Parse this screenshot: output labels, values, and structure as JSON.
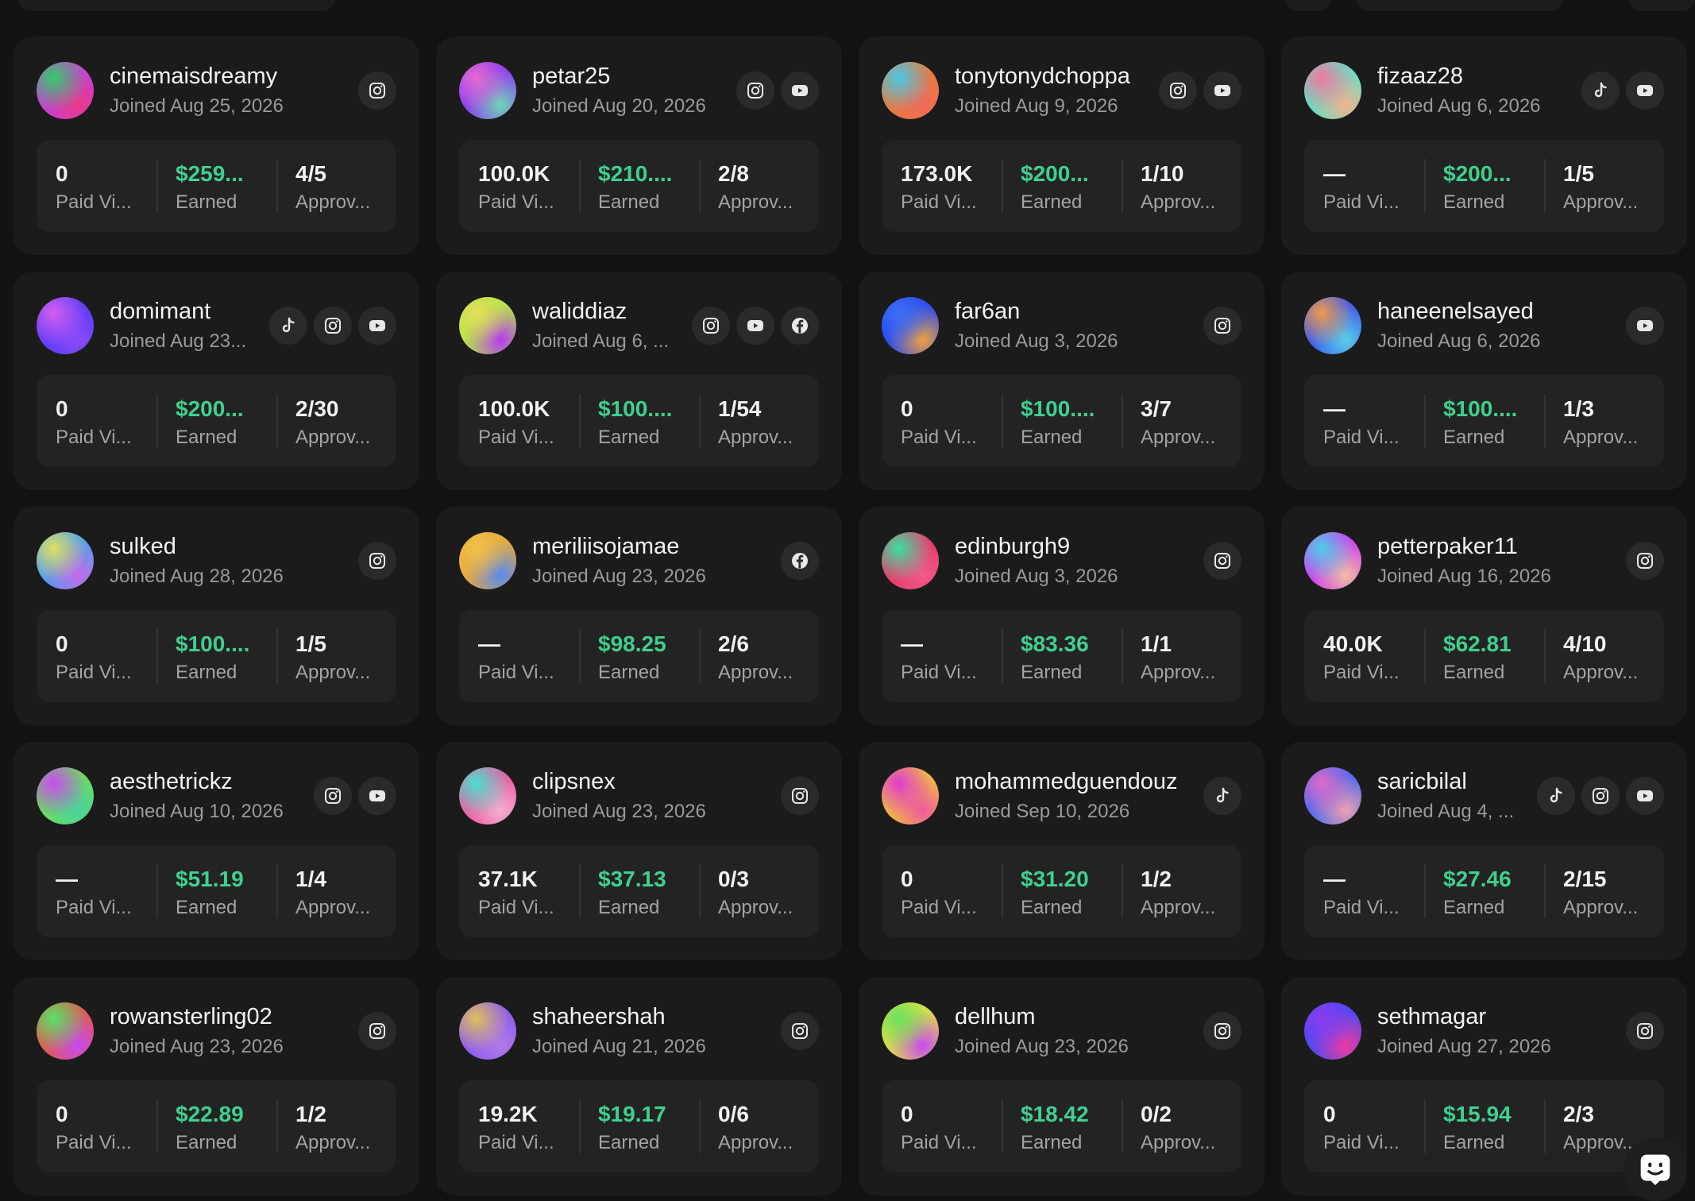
{
  "labels": {
    "views": "Paid Vi...",
    "earned": "Earned",
    "approved": "Approv..."
  },
  "colors": {
    "background": "#121212",
    "card": "#1b1b1b",
    "stat_panel": "#232323",
    "earned_green": "#3fd08f",
    "muted_text": "#9a9a9a"
  },
  "creators": [
    {
      "username": "cinemaisdreamy",
      "joined": "Joined Aug 25, 2026",
      "views": "0",
      "earned": "$259...",
      "approved": "4/5",
      "socials": [
        "instagram-icon"
      ],
      "avatar": [
        "#c93dd6",
        "#35c96a",
        "#e83a8a"
      ]
    },
    {
      "username": "petar25",
      "joined": "Joined Aug 20, 2026",
      "views": "100.0K",
      "earned": "$210....",
      "approved": "2/8",
      "socials": [
        "instagram-icon",
        "youtube-icon"
      ],
      "avatar": [
        "#8a3cf0",
        "#e66bd0",
        "#6fd6b8"
      ]
    },
    {
      "username": "tonytonydchoppa",
      "joined": "Joined Aug 9, 2026",
      "views": "173.0K",
      "earned": "$200...",
      "approved": "1/10",
      "socials": [
        "instagram-icon",
        "youtube-icon"
      ],
      "avatar": [
        "#e87b3c",
        "#4bc7e8",
        "#f06a5a"
      ]
    },
    {
      "username": "fizaaz28",
      "joined": "Joined Aug 6, 2026",
      "views": "—",
      "earned": "$200...",
      "approved": "1/5",
      "socials": [
        "tiktok-icon",
        "youtube-icon"
      ],
      "avatar": [
        "#5fe0c8",
        "#f07aa0",
        "#f2b48c"
      ]
    },
    {
      "username": "domimant",
      "joined": "Joined Aug 23...",
      "views": "0",
      "earned": "$200...",
      "approved": "2/30",
      "socials": [
        "tiktok-icon",
        "instagram-icon",
        "youtube-icon"
      ],
      "avatar": [
        "#5a3cf5",
        "#d55ef0",
        "#8a4af8"
      ]
    },
    {
      "username": "waliddiaz",
      "joined": "Joined Aug 6, ...",
      "views": "100.0K",
      "earned": "$100....",
      "approved": "1/54",
      "socials": [
        "instagram-icon",
        "youtube-icon",
        "facebook-icon"
      ],
      "avatar": [
        "#b6e24a",
        "#e0e05a",
        "#b23cf0"
      ]
    },
    {
      "username": "far6an",
      "joined": "Joined Aug 3, 2026",
      "views": "0",
      "earned": "$100....",
      "approved": "3/7",
      "socials": [
        "instagram-icon"
      ],
      "avatar": [
        "#2a4af0",
        "#3c6ef5",
        "#f0a040"
      ]
    },
    {
      "username": "haneenelsayed",
      "joined": "Joined Aug 6, 2026",
      "views": "—",
      "earned": "$100....",
      "approved": "1/3",
      "socials": [
        "youtube-icon"
      ],
      "avatar": [
        "#3c5af0",
        "#f09a4a",
        "#5ad0e8"
      ]
    },
    {
      "username": "sulked",
      "joined": "Joined Aug 28, 2026",
      "views": "0",
      "earned": "$100....",
      "approved": "1/5",
      "socials": [
        "instagram-icon"
      ],
      "avatar": [
        "#4aa0f0",
        "#e0e060",
        "#c86ae8"
      ]
    },
    {
      "username": "meriliisojamae",
      "joined": "Joined Aug 23, 2026",
      "views": "—",
      "earned": "$98.25",
      "approved": "2/6",
      "socials": [
        "facebook-icon"
      ],
      "avatar": [
        "#e8a83c",
        "#f0c04a",
        "#5a8af0"
      ]
    },
    {
      "username": "edinburgh9",
      "joined": "Joined Aug 3, 2026",
      "views": "—",
      "earned": "$83.36",
      "approved": "1/1",
      "socials": [
        "instagram-icon"
      ],
      "avatar": [
        "#e83a6a",
        "#3ce0a0",
        "#f05a8a"
      ]
    },
    {
      "username": "petterpaker11",
      "joined": "Joined Aug 16, 2026",
      "views": "40.0K",
      "earned": "$62.81",
      "approved": "4/10",
      "socials": [
        "instagram-icon"
      ],
      "avatar": [
        "#d23cf0",
        "#4ad0e8",
        "#f0c0a0"
      ]
    },
    {
      "username": "aesthetrickz",
      "joined": "Joined Aug 10, 2026",
      "views": "—",
      "earned": "$51.19",
      "approved": "1/4",
      "socials": [
        "instagram-icon",
        "youtube-icon"
      ],
      "avatar": [
        "#6ae05a",
        "#c84af0",
        "#4ad0a0"
      ]
    },
    {
      "username": "clipsnex",
      "joined": "Joined Aug 23, 2026",
      "views": "37.1K",
      "earned": "$37.13",
      "approved": "0/3",
      "socials": [
        "instagram-icon"
      ],
      "avatar": [
        "#f05aa0",
        "#4ae0d0",
        "#f0b0d0"
      ]
    },
    {
      "username": "mohammedguendouz",
      "joined": "Joined Sep 10, 2026",
      "views": "0",
      "earned": "$31.20",
      "approved": "1/2",
      "socials": [
        "tiktok-icon"
      ],
      "avatar": [
        "#f0c03c",
        "#e03ad0",
        "#f05aa0"
      ]
    },
    {
      "username": "saricbilal",
      "joined": "Joined Aug 4, ...",
      "views": "—",
      "earned": "$27.46",
      "approved": "2/15",
      "socials": [
        "tiktok-icon",
        "instagram-icon",
        "youtube-icon"
      ],
      "avatar": [
        "#4a6af0",
        "#e06ac8",
        "#f0a0b0"
      ]
    },
    {
      "username": "rowansterling02",
      "joined": "Joined Aug 23, 2026",
      "views": "0",
      "earned": "$22.89",
      "approved": "1/2",
      "socials": [
        "instagram-icon"
      ],
      "avatar": [
        "#e05a4a",
        "#5ae06a",
        "#c84af0"
      ]
    },
    {
      "username": "shaheershah",
      "joined": "Joined Aug 21, 2026",
      "views": "19.2K",
      "earned": "$19.17",
      "approved": "0/6",
      "socials": [
        "instagram-icon"
      ],
      "avatar": [
        "#8a5af0",
        "#e0c05a",
        "#b07ae8"
      ]
    },
    {
      "username": "dellhum",
      "joined": "Joined Aug 23, 2026",
      "views": "0",
      "earned": "$18.42",
      "approved": "0/2",
      "socials": [
        "instagram-icon"
      ],
      "avatar": [
        "#e0e04a",
        "#6ae05a",
        "#c84af0"
      ]
    },
    {
      "username": "sethmagar",
      "joined": "Joined Aug 27, 2026",
      "views": "0",
      "earned": "$15.94",
      "approved": "2/3",
      "socials": [
        "instagram-icon"
      ],
      "avatar": [
        "#4a4af0",
        "#8a3cf0",
        "#f03aa0"
      ]
    }
  ]
}
